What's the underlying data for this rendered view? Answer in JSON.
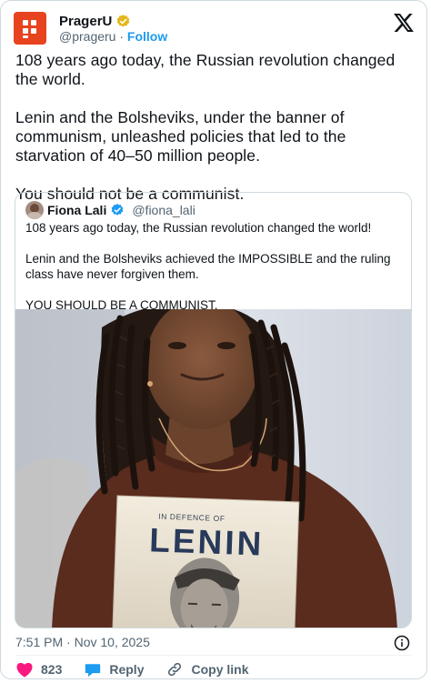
{
  "author": {
    "name": "PragerU",
    "handle": "@prageru",
    "separator": "·",
    "follow_label": "Follow"
  },
  "tweet": {
    "paragraphs": [
      "108 years ago today, the Russian revolution changed the world.",
      "Lenin and the Bolsheviks, under the banner of communism, unleashed policies that led to the starvation of 40–50 million people.",
      "You should not be a communist."
    ],
    "timestamp": "7:51 PM · Nov 10, 2025"
  },
  "quoted": {
    "name": "Fiona Lali",
    "handle": "@fiona_lali",
    "paragraphs": [
      "108 years ago today, the Russian revolution changed the world!",
      "Lenin and the Bolsheviks achieved the IMPOSSIBLE and the ruling class have never forgiven them.",
      "YOU SHOULD BE A COMMUNIST."
    ],
    "book": {
      "subtitle": "IN DEFENCE OF",
      "title": "LENIN"
    }
  },
  "actions": {
    "like_count": "823",
    "reply_label": "Reply",
    "copy_label": "Copy link"
  },
  "colors": {
    "brand": "#e8431f",
    "link": "#1d9bf0",
    "like": "#f91880",
    "verified_gold": "#e2b719",
    "verified_blue": "#1d9bf0"
  }
}
